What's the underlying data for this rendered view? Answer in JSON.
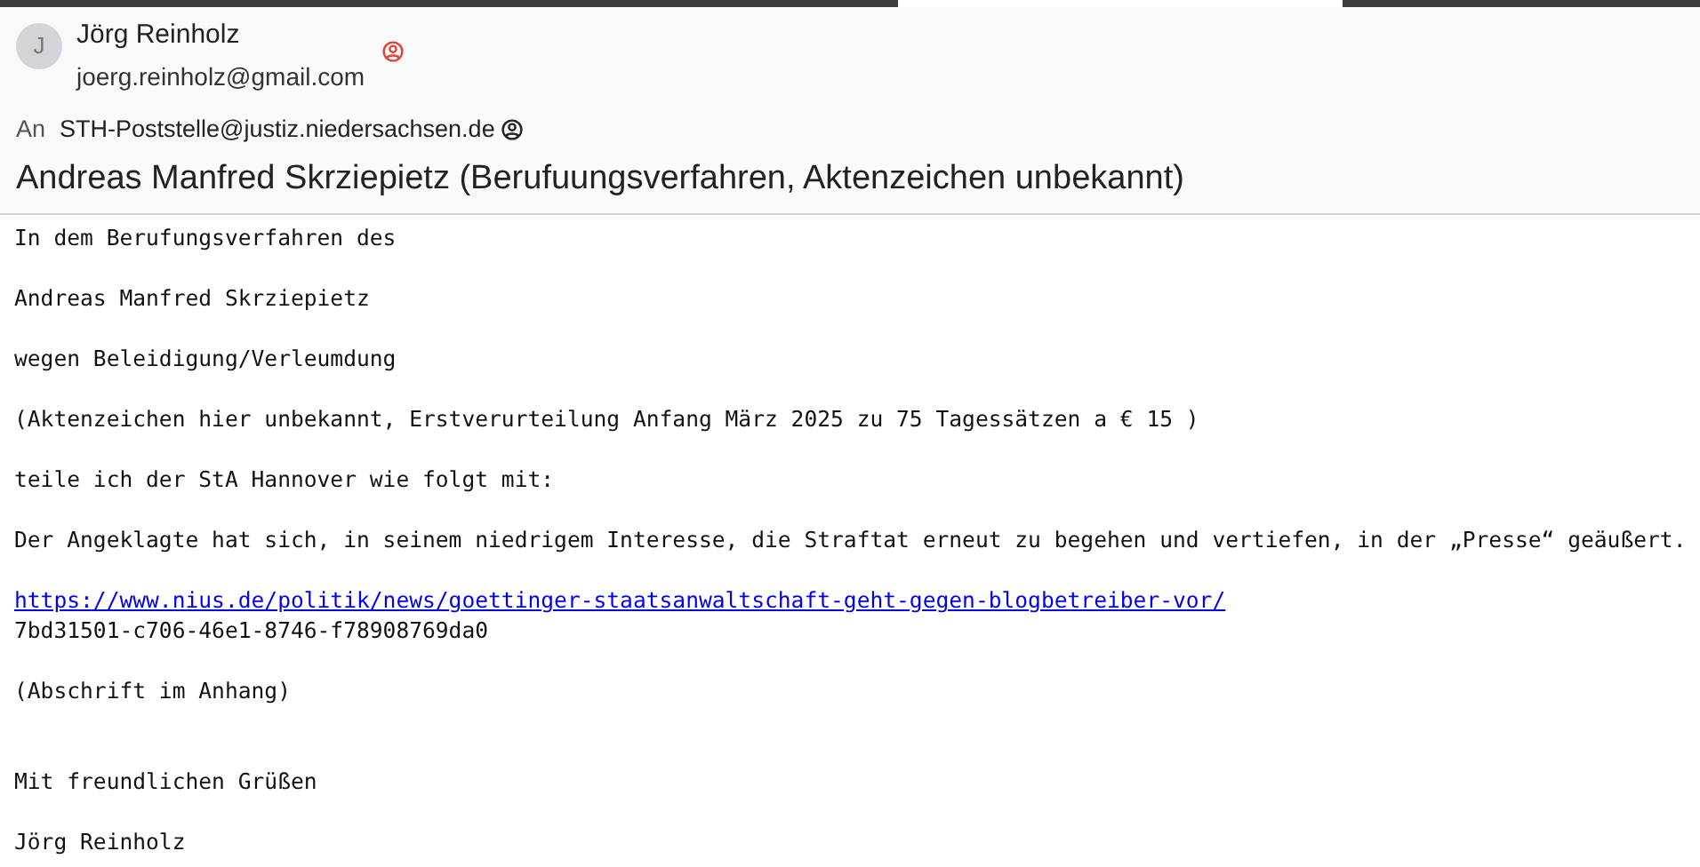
{
  "sender": {
    "avatar_letter": "J",
    "name": "Jörg Reinholz",
    "email": "joerg.reinholz@gmail.com"
  },
  "recipient": {
    "label": "An",
    "address": "STH-Poststelle@justiz.niedersachsen.de"
  },
  "subject": "Andreas Manfred Skrziepietz (Berufuungsverfahren, Aktenzeichen unbekannt)",
  "body": [
    {
      "kind": "text",
      "text": "In dem Berufungsverfahren des"
    },
    {
      "kind": "blank"
    },
    {
      "kind": "text",
      "text": "Andreas Manfred Skrziepietz"
    },
    {
      "kind": "blank"
    },
    {
      "kind": "text",
      "text": "wegen Beleidigung/Verleumdung"
    },
    {
      "kind": "blank"
    },
    {
      "kind": "text",
      "text": "(Aktenzeichen hier unbekannt, Erstverurteilung Anfang März 2025 zu 75 Tagessätzen a € 15 )"
    },
    {
      "kind": "blank"
    },
    {
      "kind": "text",
      "text": "teile ich der StA Hannover wie folgt mit:"
    },
    {
      "kind": "blank"
    },
    {
      "kind": "text",
      "text": "Der Angeklagte hat sich, in seinem niedrigem Interesse, die Straftat erneut zu begehen und vertiefen, in der „Presse“ geäußert."
    },
    {
      "kind": "blank"
    },
    {
      "kind": "link",
      "text": "https://www.nius.de/politik/news/goettinger-staatsanwaltschaft-geht-gegen-blogbetreiber-vor/"
    },
    {
      "kind": "text",
      "text": "7bd31501-c706-46e1-8746-f78908769da0"
    },
    {
      "kind": "blank"
    },
    {
      "kind": "text",
      "text": "(Abschrift im Anhang)"
    },
    {
      "kind": "blank"
    },
    {
      "kind": "blank"
    },
    {
      "kind": "text",
      "text": "Mit freundlichen Grüßen"
    },
    {
      "kind": "blank"
    },
    {
      "kind": "text",
      "text": "Jörg Reinholz"
    }
  ]
}
